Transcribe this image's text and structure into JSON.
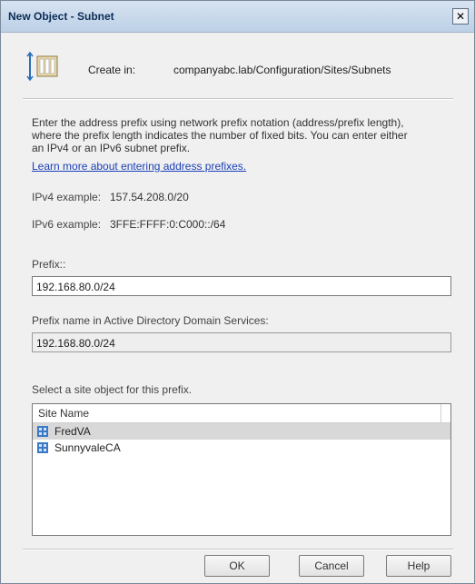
{
  "window": {
    "title": "New Object - Subnet",
    "close_glyph": "✕"
  },
  "create_in": {
    "label": "Create in:",
    "path": "companyabc.lab/Configuration/Sites/Subnets",
    "icon": "folder-icon"
  },
  "description": {
    "text": "Enter the address prefix using network prefix notation (address/prefix length), where the prefix length indicates the number of fixed bits. You can enter either an IPv4 or an IPv6 subnet prefix.",
    "link": "Learn more about entering address prefixes."
  },
  "examples": {
    "ipv4_label": "IPv4 example:",
    "ipv4_value": "157.54.208.0/20",
    "ipv6_label": "IPv6 example:",
    "ipv6_value": "3FFE:FFFF:0:C000::/64"
  },
  "prefix": {
    "label": "Prefix::",
    "value": "192.168.80.0/24"
  },
  "prefix_name": {
    "label": "Prefix name in Active Directory Domain Services:",
    "value": "192.168.80.0/24"
  },
  "sites": {
    "label": "Select a site object for this prefix.",
    "column_header": "Site Name",
    "items": [
      {
        "name": "FredVA",
        "selected": true,
        "icon": "site-icon"
      },
      {
        "name": "SunnyvaleCA",
        "selected": false,
        "icon": "site-icon"
      }
    ]
  },
  "buttons": {
    "ok": "OK",
    "cancel": "Cancel",
    "help": "Help"
  },
  "colors": {
    "link": "#1a3fb8",
    "title": "#0c2d57",
    "selection": "#d8d8d8"
  }
}
